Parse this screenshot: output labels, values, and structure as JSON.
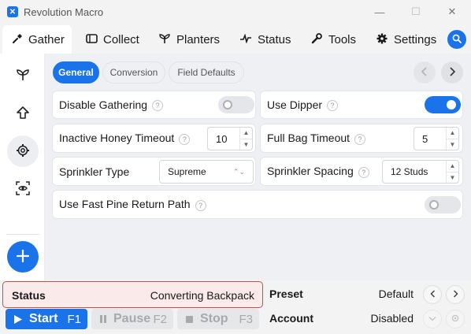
{
  "app": {
    "title": "Revolution Macro",
    "logo_glyph": "✕",
    "accent": "#1a73e8"
  },
  "window_controls": {
    "minimize": "—",
    "maximize": "☐",
    "close": "✕"
  },
  "nav": {
    "tabs": [
      {
        "label": "Gather",
        "icon": "shovel-icon",
        "active": true
      },
      {
        "label": "Collect",
        "icon": "ticket-icon"
      },
      {
        "label": "Planters",
        "icon": "sprout-icon"
      },
      {
        "label": "Status",
        "icon": "pulse-icon"
      },
      {
        "label": "Tools",
        "icon": "wrench-icon"
      },
      {
        "label": "Settings",
        "icon": "gear-icon"
      }
    ]
  },
  "subtabs": [
    "General",
    "Conversion",
    "Field Defaults"
  ],
  "settings": {
    "disable_gathering": {
      "label": "Disable Gathering",
      "on": false
    },
    "use_dipper": {
      "label": "Use Dipper",
      "on": true
    },
    "inactive_honey_timeout": {
      "label": "Inactive Honey Timeout",
      "value": "10"
    },
    "full_bag_timeout": {
      "label": "Full Bag Timeout",
      "value": "5"
    },
    "sprinkler_type": {
      "label": "Sprinkler Type",
      "value": "Supreme"
    },
    "sprinkler_spacing": {
      "label": "Sprinkler Spacing",
      "value": "12 Studs"
    },
    "fast_pine": {
      "label": "Use Fast Pine Return Path",
      "on": false
    }
  },
  "help_glyph": "?",
  "status": {
    "label": "Status",
    "value": "Converting Backpack"
  },
  "controls": {
    "start": {
      "label": "Start",
      "key": "F1"
    },
    "pause": {
      "label": "Pause",
      "key": "F2"
    },
    "stop": {
      "label": "Stop",
      "key": "F3"
    }
  },
  "preset": {
    "label": "Preset",
    "value": "Default"
  },
  "account": {
    "label": "Account",
    "value": "Disabled"
  }
}
